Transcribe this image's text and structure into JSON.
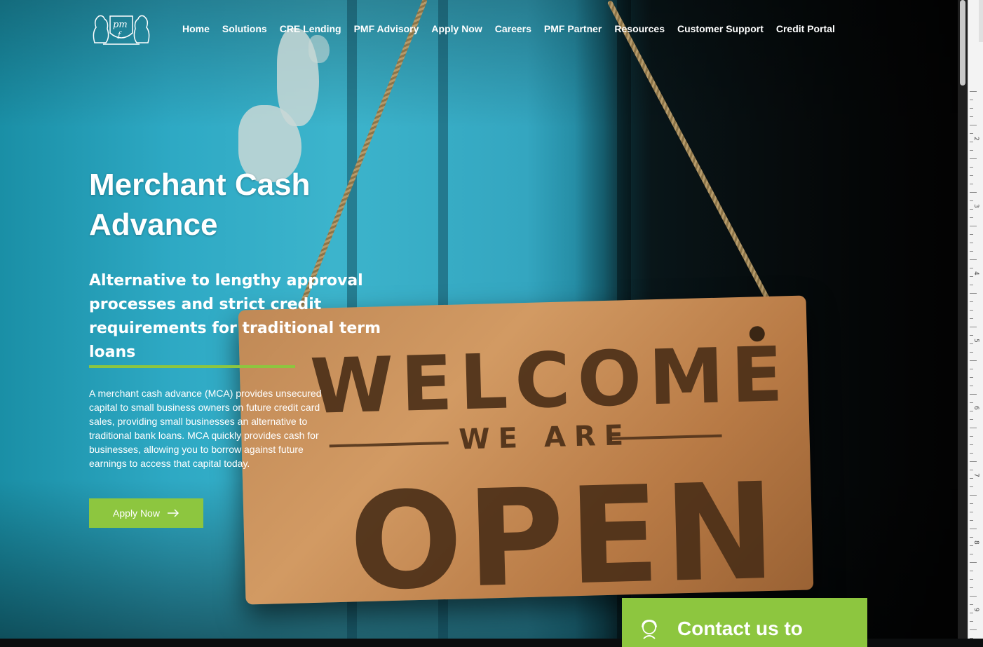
{
  "nav": {
    "logo_alt": "PMF",
    "items": [
      {
        "label": "Home"
      },
      {
        "label": "Solutions"
      },
      {
        "label": "CRE Lending"
      },
      {
        "label": "PMF Advisory"
      },
      {
        "label": "Apply Now"
      },
      {
        "label": "Careers"
      },
      {
        "label": "PMF Partner"
      },
      {
        "label": "Resources"
      },
      {
        "label": "Customer Support"
      },
      {
        "label": "Credit Portal"
      }
    ]
  },
  "hero": {
    "title": "Merchant Cash Advance",
    "subtitle": "Alternative to lengthy approval processes and strict credit requirements for traditional term loans",
    "description": "A merchant cash advance (MCA) provides unsecured capital to small business owners on future credit card sales, providing small businesses an alternative to traditional bank loans. MCA quickly provides cash for businesses, allowing you to borrow against future earnings to access that capital today.",
    "cta_label": "Apply Now",
    "sign": {
      "line1": "WELCOME",
      "line2": "WE ARE",
      "line3": "OPEN"
    }
  },
  "contact_card": {
    "text": "Contact us to"
  },
  "ruler": {
    "numbers": [
      "2",
      "3",
      "4",
      "5",
      "6",
      "7",
      "8",
      "9"
    ]
  },
  "colors": {
    "accent": "#8dc63f",
    "text": "#ffffff"
  }
}
